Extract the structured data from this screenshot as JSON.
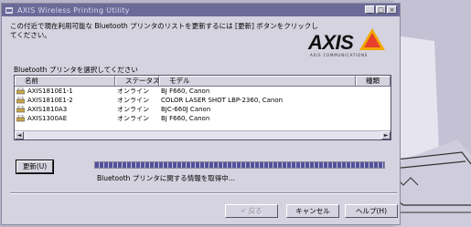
{
  "window": {
    "title": "AXIS Wireless Printing Utility",
    "min_glyph": "_",
    "max_glyph": "□",
    "close_glyph": "×"
  },
  "description": "この付近で現在利用可能な Bluetooth プリンタのリストを更新するには [更新] ボタンをクリックしてください。",
  "logo": {
    "text": "AXIS",
    "tagline": "AXIS COMMUNICATIONS"
  },
  "list": {
    "label": "Bluetooth プリンタを選択してください",
    "columns": [
      "名前",
      "ステータス",
      "モデル",
      "種類"
    ],
    "rows": [
      {
        "name": "AXIS1810E1-1",
        "status": "オンライン",
        "model": "BJ F660, Canon",
        "type": ""
      },
      {
        "name": "AXIS1810E1-2",
        "status": "オンライン",
        "model": "COLOR LASER SHOT LBP-2360, Canon",
        "type": ""
      },
      {
        "name": "AXIS1810A3",
        "status": "オンライン",
        "model": "BJC-660J Canon",
        "type": ""
      },
      {
        "name": "AXIS1300AE",
        "status": "オンライン",
        "model": "BJ F660, Canon",
        "type": ""
      }
    ],
    "scroll_left": "◄",
    "scroll_right": "►"
  },
  "update_button": "更新(U)",
  "progress": {
    "value": 1.0,
    "status_text": "Bluetooth プリンタに関する情報を取得中..."
  },
  "buttons": {
    "back": "< 戻る",
    "cancel": "キャンセル",
    "help": "ヘルプ(H)"
  },
  "colors": {
    "titlebar": "#6b6a98",
    "window_bg": "#d5d3df",
    "progress_fill": "#54519d",
    "logo_accent": "#f2a900"
  }
}
